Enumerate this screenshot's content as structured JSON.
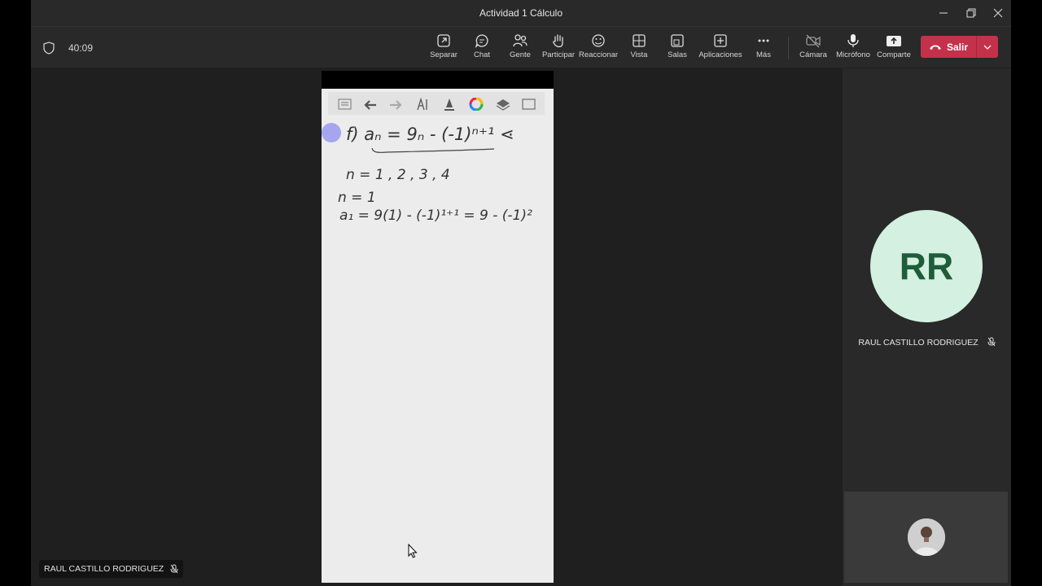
{
  "window": {
    "title": "Actividad 1 Cálculo"
  },
  "toolbar": {
    "timer": "40:09",
    "buttons": [
      {
        "label": "Separar",
        "icon": "pop-out-icon"
      },
      {
        "label": "Chat",
        "icon": "chat-icon"
      },
      {
        "label": "Gente",
        "icon": "people-icon"
      },
      {
        "label": "Participar",
        "icon": "raise-hand-icon"
      },
      {
        "label": "Reaccionar",
        "icon": "smiley-icon"
      },
      {
        "label": "Vista",
        "icon": "grid-view-icon"
      },
      {
        "label": "Salas",
        "icon": "breakout-rooms-icon"
      },
      {
        "label": "Aplicaciones",
        "icon": "add-apps-icon"
      },
      {
        "label": "Más",
        "icon": "more-icon"
      },
      {
        "label": "Cámara",
        "icon": "camera-off-icon"
      },
      {
        "label": "Micrófono",
        "icon": "microphone-icon"
      },
      {
        "label": "Comparte",
        "icon": "share-screen-icon"
      }
    ],
    "leave_label": "Salir"
  },
  "shared_content": {
    "lines": [
      "f)  aₙ = 9ₙ - (-1)ⁿ⁺¹  ⋖",
      "n = 1 , 2 , 3 , 4",
      "n = 1",
      "a₁ = 9(1) - (-1)¹⁺¹ = 9 - (-1)²"
    ]
  },
  "stage": {
    "presenter_name": "RAUL CASTILLO RODRIGUEZ"
  },
  "participant": {
    "initials": "RR",
    "name": "RAUL CASTILLO RODRIGUEZ",
    "avatar_color": "#d4f0e0",
    "initials_color": "#1f5c3a"
  },
  "colors": {
    "leave_button": "#c4314b",
    "toolbar_bg": "#292929",
    "stage_bg": "#1f1f1f"
  }
}
